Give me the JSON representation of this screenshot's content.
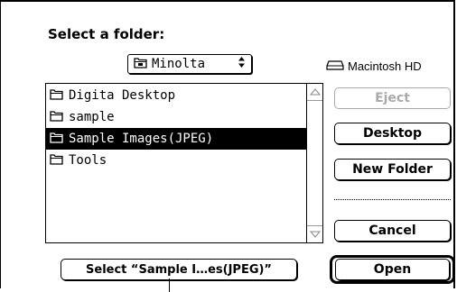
{
  "dialog": {
    "title": "Select a folder:"
  },
  "popup": {
    "selected": "Minolta",
    "icon": "folder-icon",
    "arrows_icon": "up-down-arrows-icon"
  },
  "volume": {
    "label": "Macintosh HD",
    "icon": "hard-disk-icon"
  },
  "file_list": {
    "items": [
      {
        "name": "Digita Desktop",
        "selected": false
      },
      {
        "name": "sample",
        "selected": false
      },
      {
        "name": "Sample Images(JPEG)",
        "selected": true
      },
      {
        "name": "Tools",
        "selected": false
      }
    ]
  },
  "buttons": {
    "eject": "Eject",
    "desktop": "Desktop",
    "new_folder": "New Folder",
    "cancel": "Cancel",
    "open": "Open",
    "select": "Select “Sample I…es(JPEG)”"
  }
}
